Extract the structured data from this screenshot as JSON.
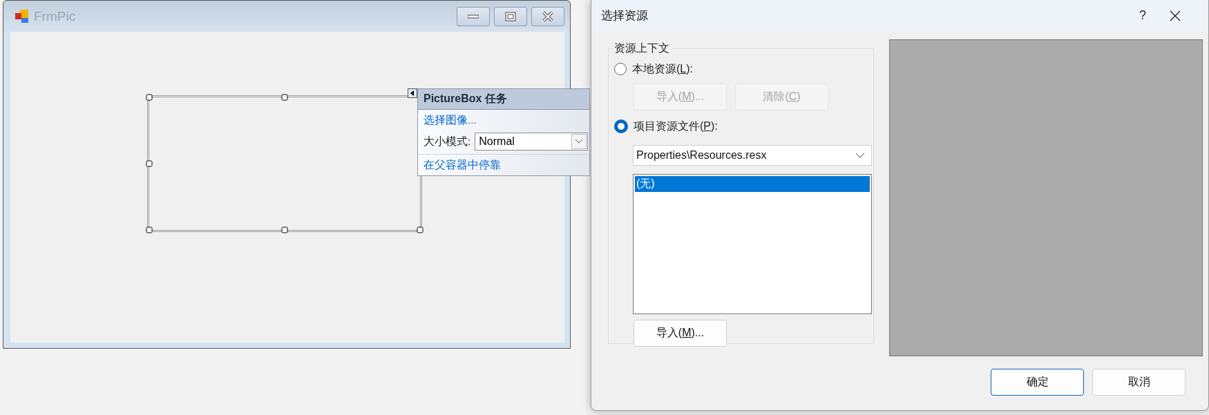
{
  "form_window": {
    "title": "FrmPic",
    "picturebox": {
      "selected": true
    },
    "task_panel": {
      "title": "PictureBox 任务",
      "choose_image_link": "选择图像...",
      "size_mode_label": "大小模式:",
      "size_mode_value": "Normal",
      "dock_link": "在父容器中停靠"
    }
  },
  "dialog": {
    "title": "选择资源",
    "help": "?",
    "group_title": "资源上下文",
    "options": [
      {
        "label_parts": [
          "本地资源(",
          "L",
          "):"
        ],
        "selected": false,
        "buttons": [
          {
            "label_parts": [
              "导入(",
              "M",
              ")..."
            ],
            "disabled": true
          },
          {
            "label_parts": [
              "清除(",
              "C",
              ")"
            ],
            "disabled": true
          }
        ]
      },
      {
        "label_parts": [
          "项目资源文件(",
          "P",
          "):"
        ],
        "selected": true,
        "file_dropdown": "Properties\\Resources.resx",
        "resources": [
          {
            "label": "(无)",
            "selected": true
          }
        ],
        "buttons": [
          {
            "label_parts": [
              "导入(",
              "M",
              ")..."
            ],
            "disabled": false
          }
        ]
      }
    ],
    "footer_buttons": [
      {
        "label": "确定",
        "default": true
      },
      {
        "label": "取消",
        "default": false
      }
    ]
  }
}
